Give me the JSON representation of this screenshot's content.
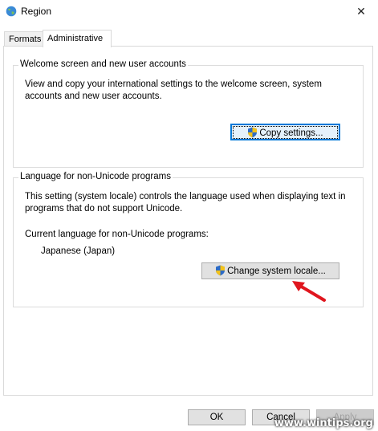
{
  "window": {
    "title": "Region",
    "close_glyph": "✕"
  },
  "tabs": [
    {
      "label": "Formats",
      "active": false
    },
    {
      "label": "Administrative",
      "active": true
    }
  ],
  "welcome_group": {
    "legend": "Welcome screen and new user accounts",
    "description": "View and copy your international settings to the welcome screen, system accounts and new user accounts.",
    "button_label": "Copy settings..."
  },
  "nonunicode_group": {
    "legend": "Language for non-Unicode programs",
    "description": "This setting (system locale) controls the language used when displaying text in programs that do not support Unicode.",
    "current_label": "Current language for non-Unicode programs:",
    "current_value": "Japanese (Japan)",
    "button_label": "Change system locale..."
  },
  "footer": {
    "ok_label": "OK",
    "cancel_label": "Cancel",
    "apply_label": "Apply"
  },
  "watermark": "www.wintips.org",
  "colors": {
    "focus_border": "#0078d7",
    "annotation_arrow": "#e0161e"
  },
  "icons": {
    "app": "globe-icon",
    "uac": "uac-shield-icon",
    "annotation": "red-arrow-icon"
  }
}
